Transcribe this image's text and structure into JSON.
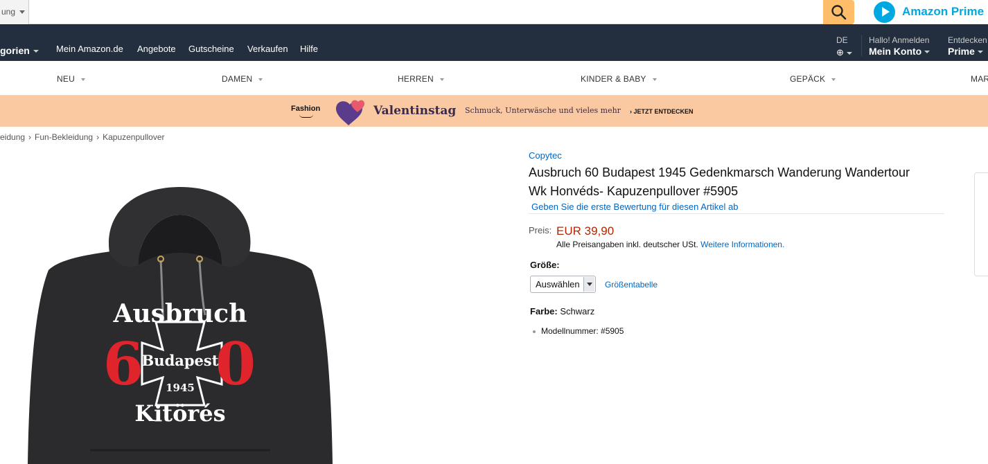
{
  "search": {
    "category_label": "ung",
    "button_icon": "search-icon"
  },
  "prime": {
    "label": "Amazon Prime"
  },
  "nav": {
    "categories_label": "gorien",
    "links": [
      "Mein Amazon.de",
      "Angebote",
      "Gutscheine",
      "Verkaufen",
      "Hilfe"
    ],
    "lang_code": "DE",
    "account_line1": "Hallo! Anmelden",
    "account_line2": "Mein Konto",
    "prime_line1": "Entdecken",
    "prime_line2": "Prime"
  },
  "subnav": [
    "NEU",
    "DAMEN",
    "HERREN",
    "KINDER & BABY",
    "GEPÄCK",
    "MAR"
  ],
  "banner": {
    "fashion_logo": "Fashion",
    "title": "Valentinstag",
    "subtitle": "Schmuck, Unterwäsche und vieles mehr",
    "cta": "› JETZT ENTDECKEN",
    "colors": {
      "background": "#fac9a1",
      "heart_purple": "#5b3b8c",
      "heart_pink": "#e8586f"
    }
  },
  "breadcrumb": [
    "eidung",
    "Fun-Bekleidung",
    "Kapuzenpullover"
  ],
  "product": {
    "brand": "Copytec",
    "title_line1": "Ausbruch 60 Budapest 1945 Gedenkmarsch Wanderung Wandertour",
    "title_line2": "Wk Honvéds- Kapuzenpullover #5905",
    "review_link": "Geben Sie die erste Bewertung für diesen Artikel ab",
    "price_label": "Preis:",
    "price": "EUR 39,90",
    "price_note": "Alle Preisangaben inkl. deutscher USt.",
    "price_note_link": "Weitere Informationen.",
    "size_label": "Größe:",
    "size_selected": "Auswählen",
    "size_chart_link": "Größentabelle",
    "color_label": "Farbe:",
    "color_value": "Schwarz",
    "model_number": "Modellnummer: #5905",
    "image": {
      "print_top": "Ausbruch",
      "print_number_left": "6",
      "print_number_right": "0",
      "print_city": "Budapest",
      "print_year": "1945",
      "print_bottom": "Kitörés",
      "colors": {
        "hoodie": "#2b2b2d",
        "number": "#e0242c",
        "text": "#ffffff"
      }
    }
  },
  "colors": {
    "nav_bg": "#232f3e",
    "link": "#0066c0",
    "price": "#b12704",
    "search_button": "#febd69",
    "prime_blue": "#00a8e1"
  }
}
